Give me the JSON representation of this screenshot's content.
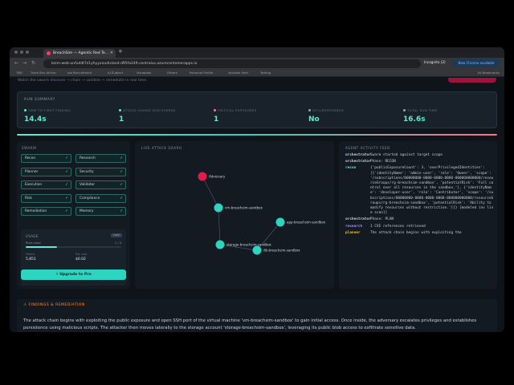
{
  "browser": {
    "tab_title": "BreachSim — Agentic Red Te...",
    "url": "bsim-web-unfuddt7z1yhy.proudisland-d95fa249.centralus.azurecontainerapps.io",
    "incognito_label": "Incognito (2)",
    "new_chrome_label": "New Chrome available",
    "bookmarks": [
      "TBD",
      "Track Bus Airline",
      "Job Recruitment",
      "AI Subject",
      "Vocabook",
      "Others",
      "Personal Profile",
      "Variable Sets",
      "Testing"
    ],
    "all_bookmarks_label": "All Bookmarks"
  },
  "header": {
    "subtitle": "Watch the swarm discover → chain → validate → remediate in real time."
  },
  "summary": {
    "title": "RUN SUMMARY",
    "stats": [
      {
        "label": "TIME TO FIRST FINDING",
        "value": "14.4s",
        "color": "#5eead4"
      },
      {
        "label": "ATTACK CHAINS DISCOVERED",
        "value": "1",
        "color": "#5eead4"
      },
      {
        "label": "CRITICAL EXPOSURES",
        "value": "1",
        "color": "#f472b6"
      },
      {
        "label": "HITL/RESPONDED",
        "value": "No",
        "color": "#94a3b8"
      },
      {
        "label": "TOTAL RUN TIME",
        "value": "16.6s",
        "color": "#94a3b8"
      }
    ]
  },
  "swarm": {
    "title": "SWARM",
    "agents": [
      "Recon",
      "Research",
      "Planner",
      "Security",
      "Execution",
      "Validator",
      "Risk",
      "Compliance",
      "Remediation",
      "Memory"
    ],
    "check": "✓"
  },
  "usage": {
    "title": "USAGE",
    "badge": "FREE",
    "runs_label": "Runs used",
    "runs_value": "1 / 3",
    "runs_fraction": 0.33,
    "tokens_label": "Tokens",
    "tokens_value": "5,851",
    "cost_label": "Est. cost",
    "cost_value": "$0.02",
    "upgrade_label": "⚡ Upgrade to Pro"
  },
  "graph": {
    "title": "LIVE ATTACK GRAPH",
    "nodes": [
      {
        "id": "adversary",
        "label": "Adversary",
        "color": "#e11d48"
      },
      {
        "id": "vm",
        "label": "vm-breachsim-sandbox",
        "color": "#2dd4bf"
      },
      {
        "id": "app",
        "label": "app-breachsim-sandbox",
        "color": "#2dd4bf"
      },
      {
        "id": "storage",
        "label": "storage-breachsim-sandbox",
        "color": "#2dd4bf"
      },
      {
        "id": "db",
        "label": "db-breachsim-sandbox",
        "color": "#2dd4bf"
      }
    ],
    "edges": [
      [
        "adversary",
        "vm"
      ],
      [
        "vm",
        "storage"
      ],
      [
        "storage",
        "db"
      ],
      [
        "app",
        "db"
      ]
    ]
  },
  "feed": {
    "title": "AGENT ACTIVITY FEED",
    "entries": [
      {
        "role": "orchestrator",
        "msg": "Swarm started against target scope",
        "color": "#cbd5e1"
      },
      {
        "role": "orchestrator",
        "msg": "Phase: RECON",
        "color": "#cbd5e1"
      },
      {
        "role": "recon",
        "msg": "{'publicExposureCount': 3, 'overPrivilegedIdentities': [{'identityName': 'admin-user', 'role': 'Owner', 'scope': '/subscriptions/00000000-0000-0000-0000-000000000000/resourceGroups/rg-breachsim-sandbox', 'potentialRisk': 'Full control over all resources in the sandbox.'}, {'identityName': 'developer-user', 'role': 'Contributor', 'scope': '/subscriptions/00000000-0000-0000-0000-000000000000/resourceGroups/rg-breachsim-sandbox', 'potentialRisk': 'Ability to modify resources without restriction.'}]} [modeled inv live scan]]",
        "color": "#5eead4"
      },
      {
        "role": "orchestrator",
        "msg": "Phase: PLAN",
        "color": "#cbd5e1"
      },
      {
        "role": "research",
        "msg": "1 CVE references retrieved",
        "color": "#a78bfa"
      },
      {
        "role": "planner",
        "msg": "The attack chain begins with exploiting the",
        "color": "#fbbf24"
      }
    ]
  },
  "findings": {
    "title": "⚠ FINDINGS & REMEDIATION",
    "text": "The attack chain begins with exploiting the public exposure and open SSH port of the virtual machine 'vm-breachsim-sandbox' to gain initial access. Once inside, the adversary escalates privileges and establishes persistence using malicious scripts. The attacker then moves laterally to the storage account 'storage-breachsim-sandbox', leveraging its public blob access to exfiltrate sensitive data."
  }
}
